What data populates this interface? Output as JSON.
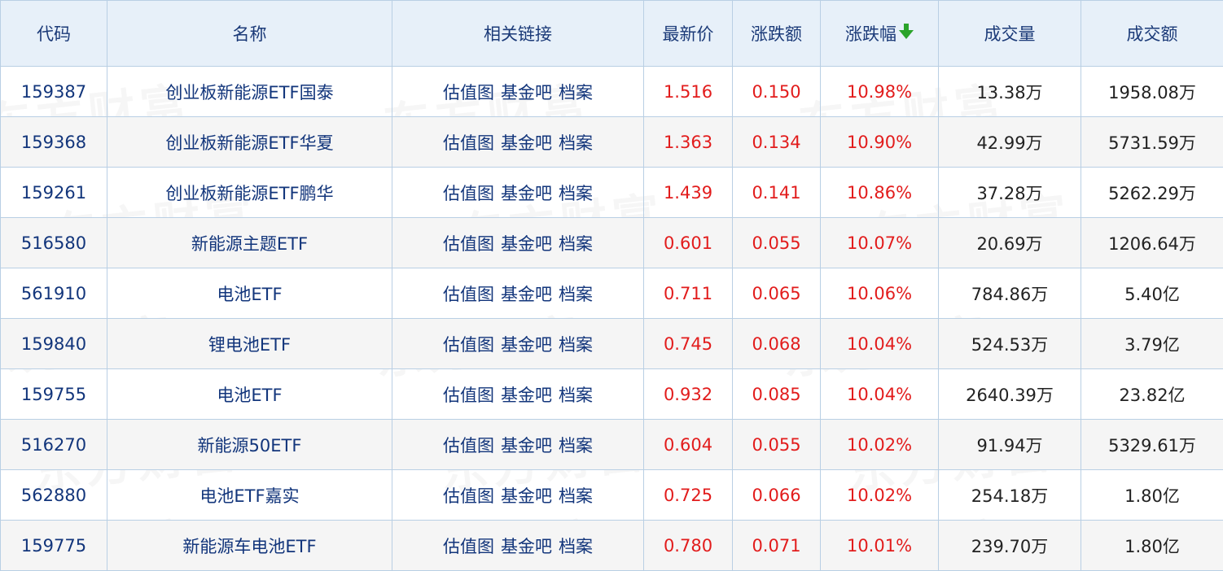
{
  "headers": {
    "code": "代码",
    "name": "名称",
    "links": "相关链接",
    "price": "最新价",
    "change": "涨跌额",
    "change_pct": "涨跌幅",
    "volume": "成交量",
    "amount": "成交额"
  },
  "sort_icon": "arrow-down-icon",
  "colors": {
    "up": "#e21c1c",
    "link": "#12357b",
    "header_bg": "#e7f0f9",
    "sort_arrow": "#2aa32a"
  },
  "watermark": "东方财富",
  "rows": [
    {
      "code": "159387",
      "name": "创业板新能源ETF国泰",
      "links": [
        "估值图",
        "基金吧",
        "档案"
      ],
      "price": "1.516",
      "change": "0.150",
      "change_pct": "10.98%",
      "volume": "13.38万",
      "amount": "1958.08万"
    },
    {
      "code": "159368",
      "name": "创业板新能源ETF华夏",
      "links": [
        "估值图",
        "基金吧",
        "档案"
      ],
      "price": "1.363",
      "change": "0.134",
      "change_pct": "10.90%",
      "volume": "42.99万",
      "amount": "5731.59万"
    },
    {
      "code": "159261",
      "name": "创业板新能源ETF鹏华",
      "links": [
        "估值图",
        "基金吧",
        "档案"
      ],
      "price": "1.439",
      "change": "0.141",
      "change_pct": "10.86%",
      "volume": "37.28万",
      "amount": "5262.29万"
    },
    {
      "code": "516580",
      "name": "新能源主题ETF",
      "links": [
        "估值图",
        "基金吧",
        "档案"
      ],
      "price": "0.601",
      "change": "0.055",
      "change_pct": "10.07%",
      "volume": "20.69万",
      "amount": "1206.64万"
    },
    {
      "code": "561910",
      "name": "电池ETF",
      "links": [
        "估值图",
        "基金吧",
        "档案"
      ],
      "price": "0.711",
      "change": "0.065",
      "change_pct": "10.06%",
      "volume": "784.86万",
      "amount": "5.40亿"
    },
    {
      "code": "159840",
      "name": "锂电池ETF",
      "links": [
        "估值图",
        "基金吧",
        "档案"
      ],
      "price": "0.745",
      "change": "0.068",
      "change_pct": "10.04%",
      "volume": "524.53万",
      "amount": "3.79亿"
    },
    {
      "code": "159755",
      "name": "电池ETF",
      "links": [
        "估值图",
        "基金吧",
        "档案"
      ],
      "price": "0.932",
      "change": "0.085",
      "change_pct": "10.04%",
      "volume": "2640.39万",
      "amount": "23.82亿"
    },
    {
      "code": "516270",
      "name": "新能源50ETF",
      "links": [
        "估值图",
        "基金吧",
        "档案"
      ],
      "price": "0.604",
      "change": "0.055",
      "change_pct": "10.02%",
      "volume": "91.94万",
      "amount": "5329.61万"
    },
    {
      "code": "562880",
      "name": "电池ETF嘉实",
      "links": [
        "估值图",
        "基金吧",
        "档案"
      ],
      "price": "0.725",
      "change": "0.066",
      "change_pct": "10.02%",
      "volume": "254.18万",
      "amount": "1.80亿"
    },
    {
      "code": "159775",
      "name": "新能源车电池ETF",
      "links": [
        "估值图",
        "基金吧",
        "档案"
      ],
      "price": "0.780",
      "change": "0.071",
      "change_pct": "10.01%",
      "volume": "239.70万",
      "amount": "1.80亿"
    }
  ]
}
